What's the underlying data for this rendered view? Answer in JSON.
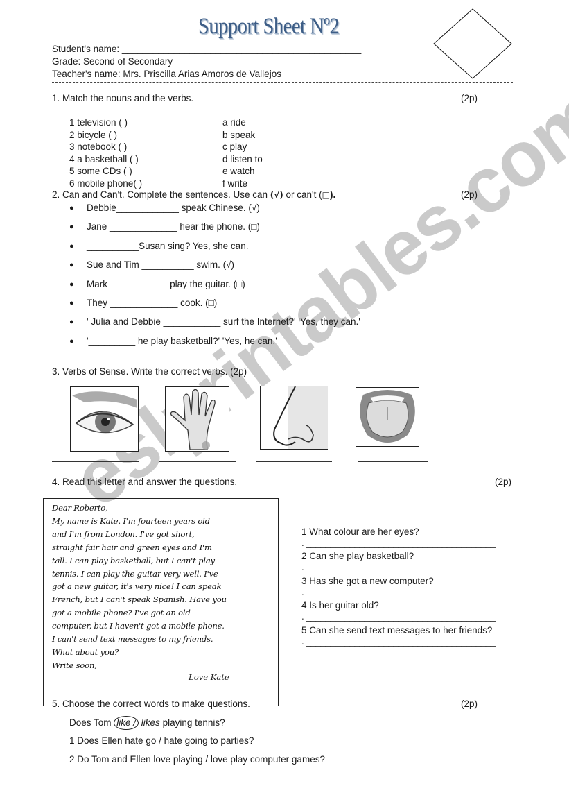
{
  "header": {
    "title": "Support Sheet Nº2",
    "student_label": "Student's name:",
    "student_blank": "______________________________________________",
    "grade": "Grade: Second of Secondary",
    "teacher": "Teacher's name: Mrs. Priscilla Arias Amoros de Vallejos",
    "grade_box_icon": "diamond-shape"
  },
  "section1": {
    "instruction": "1. Match the nouns and the verbs.",
    "points": "(2p)",
    "nouns": [
      "1 television (  )",
      "2 bicycle (  )",
      "3 notebook (  )",
      "4 a basketball (  )",
      "5 some CDs (  )",
      "6 mobile phone(  )"
    ],
    "verbs": [
      "a ride",
      "b speak",
      "c play",
      "d listen to",
      "e watch",
      "f write"
    ]
  },
  "section2": {
    "instruction_pre": "2. Can and Can't.  Complete the sentences. Use can ",
    "can_symbol": "(√)",
    "instruction_mid": " or can't (",
    "cant_symbol": "□",
    "instruction_post": ").",
    "points": "(2p)",
    "items": [
      "Debbie____________ speak Chinese. (√)",
      "Jane _____________ hear the phone. (□)",
      "__________Susan sing? Yes, she can.",
      "Sue and Tim __________ swim. (√)",
      "Mark ___________ play the guitar. (□)",
      "They _____________ cook. (□)",
      "' Julia and Debbie ___________ surf the Internet?' 'Yes, they can.'",
      "'_________ he play basketball?' 'Yes, he can.'"
    ]
  },
  "section3": {
    "instruction": "3. Verbs of Sense. Write the correct verbs. (2p)",
    "pictures": [
      "eye",
      "hand",
      "nose",
      "tongue"
    ]
  },
  "section4": {
    "instruction": "4. Read this letter and answer the questions.",
    "points": "(2p)",
    "letter_lines": [
      "Dear Roberto,",
      "My name is Kate. I'm fourteen years old",
      "and I'm from London. I've got short,",
      "straight fair hair and green eyes and I'm",
      "tall. I can play basketball, but I can't play",
      "tennis. I can play the guitar very well. I've",
      "got a new guitar, it's very nice! I can speak",
      "French, but I can't speak Spanish. Have you",
      "got a mobile phone? I've got an old",
      "computer, but I haven't got a mobile phone.",
      "I can't send text messages to my friends.",
      "What about you?",
      "Write soon,"
    ],
    "signature": "Love Kate",
    "questions": [
      "1 What colour are her eyes?",
      "2 Can she play basketball?",
      "3 Has she got a new computer?",
      "4 Is her guitar old?",
      "5 Can she send text messages to her friends?"
    ],
    "answer_blank": ". _______________________________________"
  },
  "section5": {
    "instruction": "5. Choose the correct words to make questions.",
    "points": "(2p)",
    "example_pre": "Does Tom ",
    "example_choice_a": "like /",
    "example_choice_b": " likes",
    "example_post": " playing tennis?",
    "items": [
      "1 Does Ellen hate go / hate going to parties?",
      "2 Do Tom and Ellen love playing / love play computer games?"
    ]
  },
  "watermark": "eslprintables.com"
}
